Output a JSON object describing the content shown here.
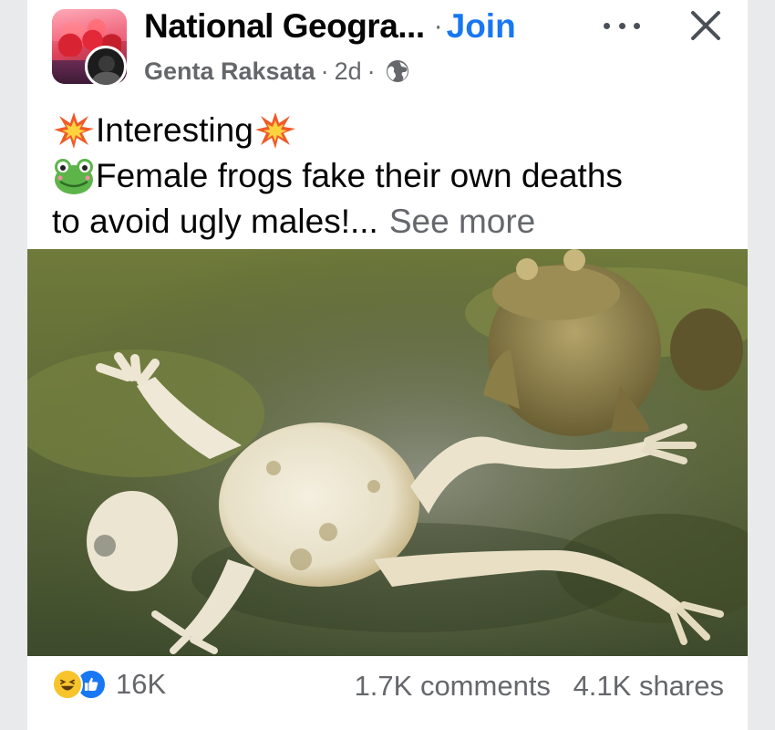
{
  "header": {
    "group_name": "National Geogra...",
    "separator": "·",
    "join_label": "Join",
    "author": "Genta Raksata",
    "time": "2d",
    "meta_dot": "·"
  },
  "post": {
    "line1": "Interesting",
    "line2": "Female frogs fake their own deaths",
    "line3": "to avoid ugly males!...",
    "see_more": "See more",
    "emoji_line1": "collision-emoji",
    "emoji_line2": "frog-emoji"
  },
  "footer": {
    "reaction_count": "16K",
    "comments": "1.7K comments",
    "shares": "4.1K shares",
    "reaction_icons": [
      "haha-icon",
      "like-icon"
    ]
  },
  "colors": {
    "link": "#1877f2",
    "secondary_text": "#65676b",
    "primary_text": "#050505"
  }
}
